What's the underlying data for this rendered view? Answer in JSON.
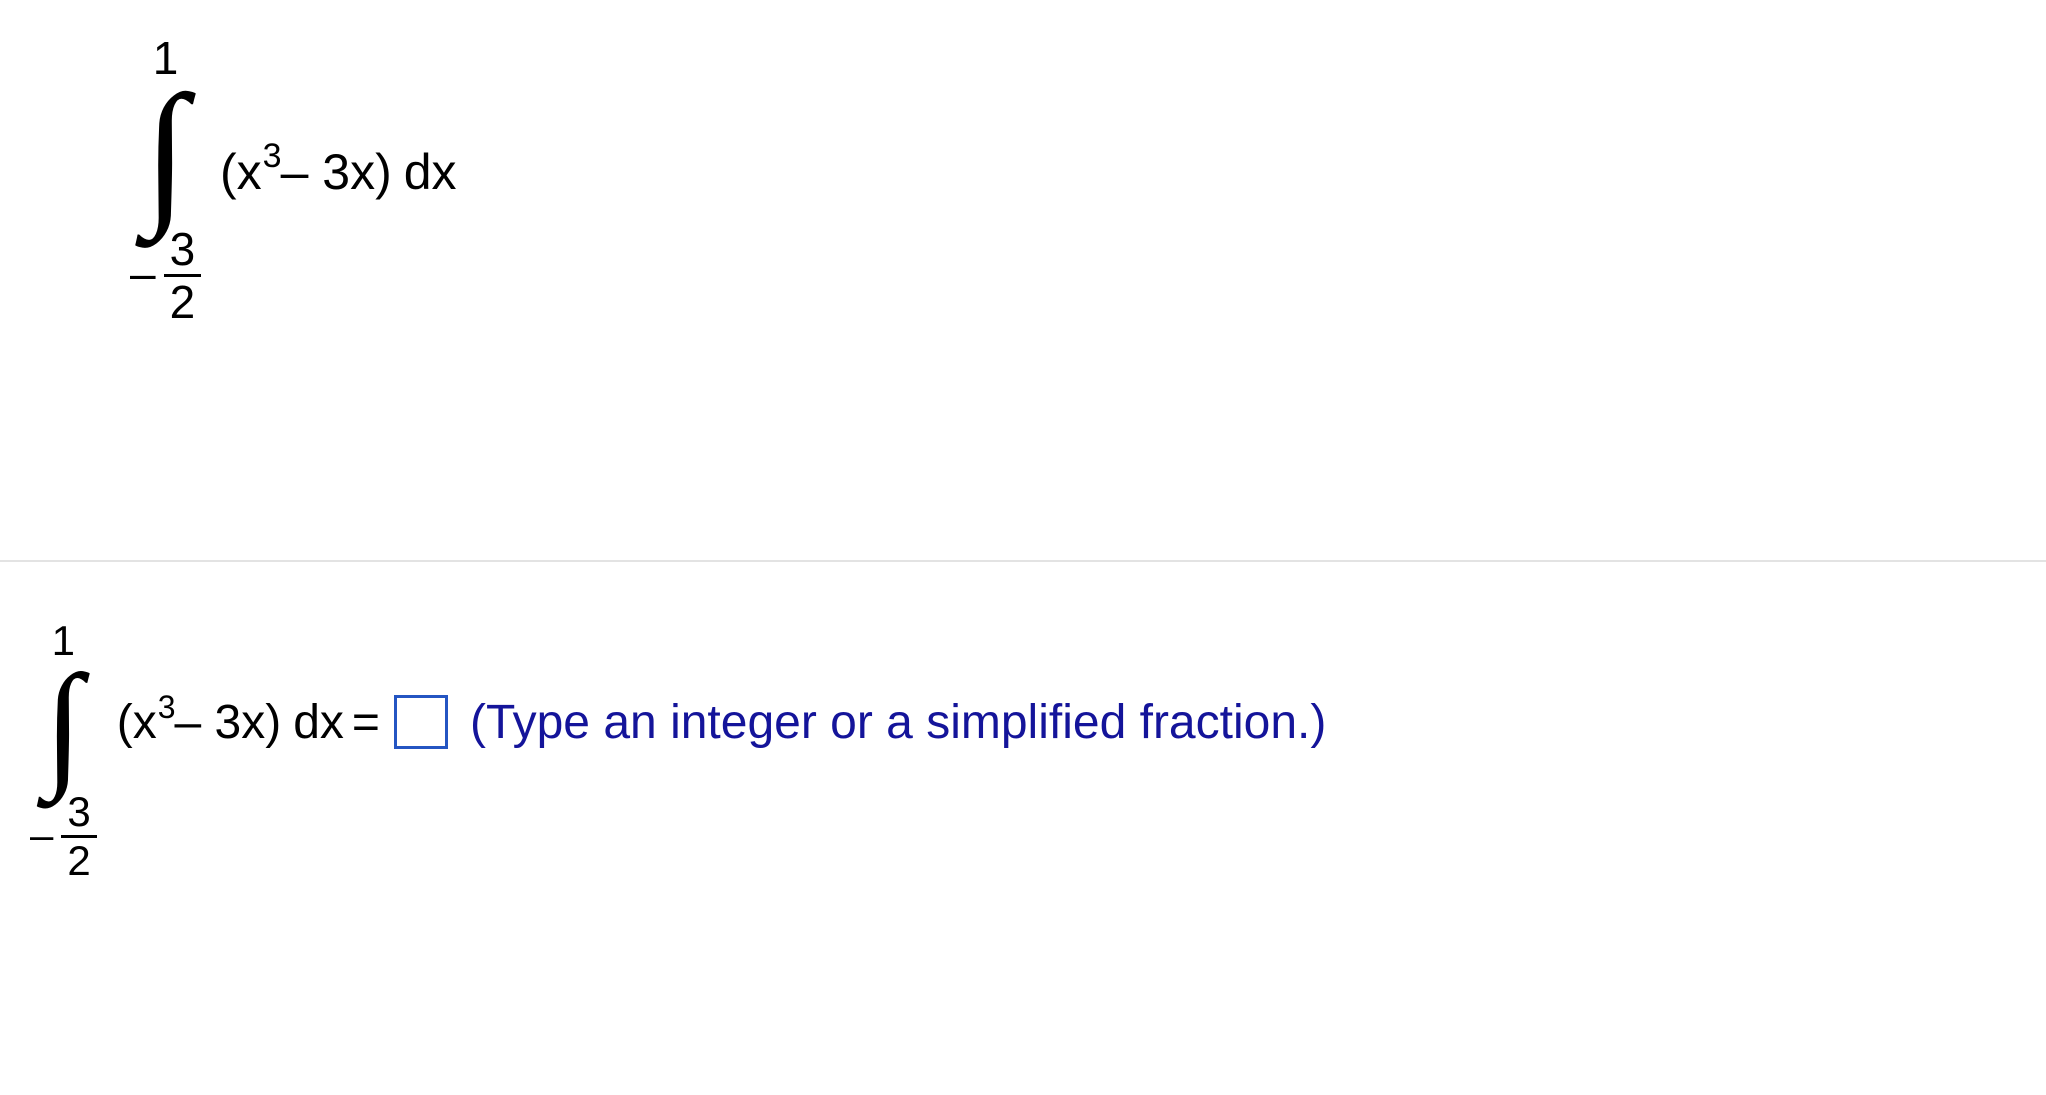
{
  "problem": {
    "upper_limit": "1",
    "lower_limit_sign": "–",
    "lower_limit_num": "3",
    "lower_limit_den": "2",
    "integrand_open": "(x",
    "integrand_exp": "3",
    "integrand_rest1": " – 3x)",
    "integrand_dx": "dx"
  },
  "answer_row": {
    "upper_limit": "1",
    "lower_limit_sign": "–",
    "lower_limit_num": "3",
    "lower_limit_den": "2",
    "integrand_open": "(x",
    "integrand_exp": "3",
    "integrand_rest1": " – 3x)",
    "integrand_dx": "dx",
    "equals": "=",
    "hint": "(Type an integer or a simplified fraction.)"
  }
}
